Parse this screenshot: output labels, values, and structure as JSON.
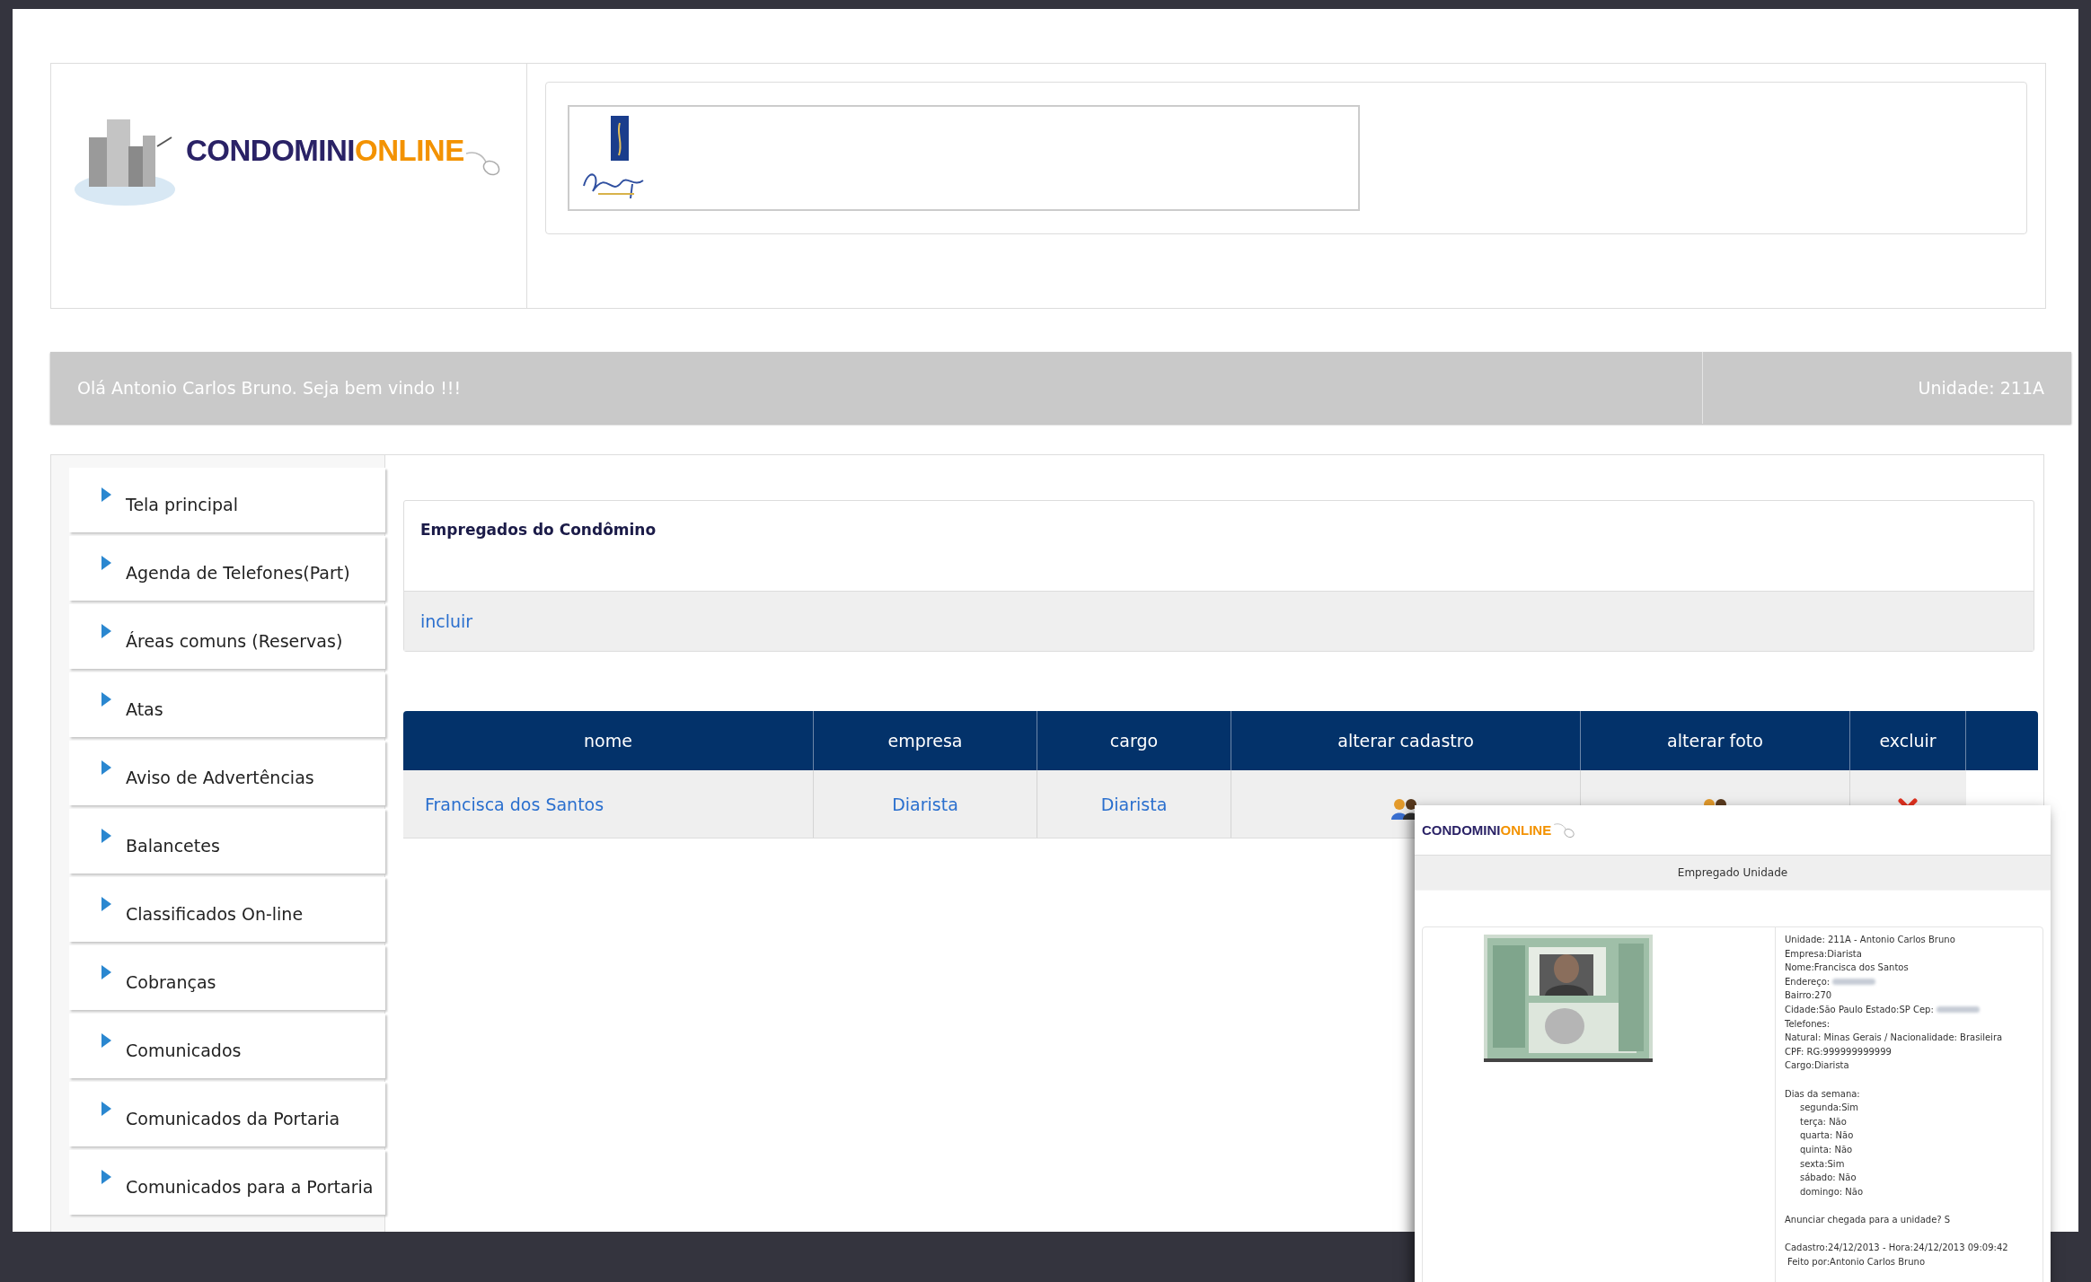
{
  "header": {
    "logo": {
      "brand_a": "CONDOMINI",
      "brand_b": "ONLINE"
    }
  },
  "welcome_bar": {
    "greeting": "Olá Antonio Carlos Bruno. Seja bem vindo !!!",
    "unit": "Unidade: 211A"
  },
  "sidebar": {
    "items": [
      {
        "label": "Tela principal"
      },
      {
        "label": "Agenda de Telefones(Part)"
      },
      {
        "label": "Áreas comuns (Reservas)"
      },
      {
        "label": "Atas"
      },
      {
        "label": "Aviso de Advertências"
      },
      {
        "label": "Balancetes"
      },
      {
        "label": "Classificados On-line"
      },
      {
        "label": "Cobranças"
      },
      {
        "label": "Comunicados"
      },
      {
        "label": "Comunicados da Portaria"
      },
      {
        "label": "Comunicados para a Portaria"
      }
    ]
  },
  "content": {
    "title": "Empregados do Condômino",
    "add_link": "incluir",
    "table": {
      "columns": [
        "nome",
        "empresa",
        "cargo",
        "alterar cadastro",
        "alterar foto",
        "excluir"
      ],
      "rows": [
        {
          "nome": "Francisca dos Santos",
          "empresa": "Diarista",
          "cargo": "Diarista"
        }
      ]
    }
  },
  "popup": {
    "logo": {
      "brand_a": "CONDOMINI",
      "brand_b": "ONLINE"
    },
    "title": "Empregado Unidade",
    "details": [
      {
        "text": "Unidade: 211A - Antonio Carlos Bruno",
        "redacted": false
      },
      {
        "text": "Empresa:Diarista",
        "redacted": false
      },
      {
        "text": "Nome:Francisca dos Santos",
        "redacted": false
      },
      {
        "text": "Endereço:",
        "redacted": true
      },
      {
        "text": "Bairro:270",
        "redacted": false
      },
      {
        "text": "Cidade:São Paulo  Estado:SP  Cep:",
        "redacted": true
      },
      {
        "text": "Telefones:",
        "redacted": false
      },
      {
        "text": "Natural: Minas Gerais / Nacionalidade: Brasileira",
        "redacted": false
      },
      {
        "text": "CPF: RG:999999999999",
        "redacted": false
      },
      {
        "text": "Cargo:Diarista",
        "redacted": false
      }
    ],
    "weekdays_heading": "Dias da semana:",
    "weekdays": [
      "segunda:Sim",
      "terça: Não",
      "quarta: Não",
      "quinta: Não",
      "sexta:Sim",
      "sábado: Não",
      "domingo: Não"
    ],
    "announce": "Anunciar chegada para a unidade? S",
    "registered": "Cadastro:24/12/2013 - Hora:24/12/2013 09:09:42",
    "made_by": "Feito por:Antonio Carlos Bruno"
  }
}
